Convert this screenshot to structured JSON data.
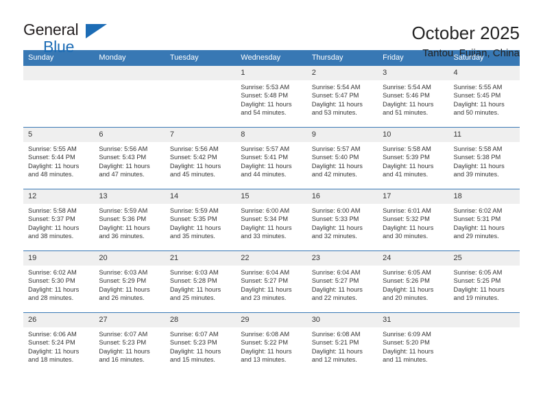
{
  "brand": {
    "name_part1": "General",
    "name_part2": "Blue"
  },
  "header": {
    "title": "October 2025",
    "subtitle": "Tantou, Fujian, China"
  },
  "colors": {
    "header_blue": "#3878b4",
    "brand_blue": "#1c6cb5",
    "daynum_bg": "#efefef",
    "text": "#333333"
  },
  "weekday_headers": [
    "Sunday",
    "Monday",
    "Tuesday",
    "Wednesday",
    "Thursday",
    "Friday",
    "Saturday"
  ],
  "weeks": [
    [
      {
        "day": "",
        "lines": []
      },
      {
        "day": "",
        "lines": []
      },
      {
        "day": "",
        "lines": []
      },
      {
        "day": "1",
        "lines": [
          "Sunrise: 5:53 AM",
          "Sunset: 5:48 PM",
          "Daylight: 11 hours",
          "and 54 minutes."
        ]
      },
      {
        "day": "2",
        "lines": [
          "Sunrise: 5:54 AM",
          "Sunset: 5:47 PM",
          "Daylight: 11 hours",
          "and 53 minutes."
        ]
      },
      {
        "day": "3",
        "lines": [
          "Sunrise: 5:54 AM",
          "Sunset: 5:46 PM",
          "Daylight: 11 hours",
          "and 51 minutes."
        ]
      },
      {
        "day": "4",
        "lines": [
          "Sunrise: 5:55 AM",
          "Sunset: 5:45 PM",
          "Daylight: 11 hours",
          "and 50 minutes."
        ]
      }
    ],
    [
      {
        "day": "5",
        "lines": [
          "Sunrise: 5:55 AM",
          "Sunset: 5:44 PM",
          "Daylight: 11 hours",
          "and 48 minutes."
        ]
      },
      {
        "day": "6",
        "lines": [
          "Sunrise: 5:56 AM",
          "Sunset: 5:43 PM",
          "Daylight: 11 hours",
          "and 47 minutes."
        ]
      },
      {
        "day": "7",
        "lines": [
          "Sunrise: 5:56 AM",
          "Sunset: 5:42 PM",
          "Daylight: 11 hours",
          "and 45 minutes."
        ]
      },
      {
        "day": "8",
        "lines": [
          "Sunrise: 5:57 AM",
          "Sunset: 5:41 PM",
          "Daylight: 11 hours",
          "and 44 minutes."
        ]
      },
      {
        "day": "9",
        "lines": [
          "Sunrise: 5:57 AM",
          "Sunset: 5:40 PM",
          "Daylight: 11 hours",
          "and 42 minutes."
        ]
      },
      {
        "day": "10",
        "lines": [
          "Sunrise: 5:58 AM",
          "Sunset: 5:39 PM",
          "Daylight: 11 hours",
          "and 41 minutes."
        ]
      },
      {
        "day": "11",
        "lines": [
          "Sunrise: 5:58 AM",
          "Sunset: 5:38 PM",
          "Daylight: 11 hours",
          "and 39 minutes."
        ]
      }
    ],
    [
      {
        "day": "12",
        "lines": [
          "Sunrise: 5:58 AM",
          "Sunset: 5:37 PM",
          "Daylight: 11 hours",
          "and 38 minutes."
        ]
      },
      {
        "day": "13",
        "lines": [
          "Sunrise: 5:59 AM",
          "Sunset: 5:36 PM",
          "Daylight: 11 hours",
          "and 36 minutes."
        ]
      },
      {
        "day": "14",
        "lines": [
          "Sunrise: 5:59 AM",
          "Sunset: 5:35 PM",
          "Daylight: 11 hours",
          "and 35 minutes."
        ]
      },
      {
        "day": "15",
        "lines": [
          "Sunrise: 6:00 AM",
          "Sunset: 5:34 PM",
          "Daylight: 11 hours",
          "and 33 minutes."
        ]
      },
      {
        "day": "16",
        "lines": [
          "Sunrise: 6:00 AM",
          "Sunset: 5:33 PM",
          "Daylight: 11 hours",
          "and 32 minutes."
        ]
      },
      {
        "day": "17",
        "lines": [
          "Sunrise: 6:01 AM",
          "Sunset: 5:32 PM",
          "Daylight: 11 hours",
          "and 30 minutes."
        ]
      },
      {
        "day": "18",
        "lines": [
          "Sunrise: 6:02 AM",
          "Sunset: 5:31 PM",
          "Daylight: 11 hours",
          "and 29 minutes."
        ]
      }
    ],
    [
      {
        "day": "19",
        "lines": [
          "Sunrise: 6:02 AM",
          "Sunset: 5:30 PM",
          "Daylight: 11 hours",
          "and 28 minutes."
        ]
      },
      {
        "day": "20",
        "lines": [
          "Sunrise: 6:03 AM",
          "Sunset: 5:29 PM",
          "Daylight: 11 hours",
          "and 26 minutes."
        ]
      },
      {
        "day": "21",
        "lines": [
          "Sunrise: 6:03 AM",
          "Sunset: 5:28 PM",
          "Daylight: 11 hours",
          "and 25 minutes."
        ]
      },
      {
        "day": "22",
        "lines": [
          "Sunrise: 6:04 AM",
          "Sunset: 5:27 PM",
          "Daylight: 11 hours",
          "and 23 minutes."
        ]
      },
      {
        "day": "23",
        "lines": [
          "Sunrise: 6:04 AM",
          "Sunset: 5:27 PM",
          "Daylight: 11 hours",
          "and 22 minutes."
        ]
      },
      {
        "day": "24",
        "lines": [
          "Sunrise: 6:05 AM",
          "Sunset: 5:26 PM",
          "Daylight: 11 hours",
          "and 20 minutes."
        ]
      },
      {
        "day": "25",
        "lines": [
          "Sunrise: 6:05 AM",
          "Sunset: 5:25 PM",
          "Daylight: 11 hours",
          "and 19 minutes."
        ]
      }
    ],
    [
      {
        "day": "26",
        "lines": [
          "Sunrise: 6:06 AM",
          "Sunset: 5:24 PM",
          "Daylight: 11 hours",
          "and 18 minutes."
        ]
      },
      {
        "day": "27",
        "lines": [
          "Sunrise: 6:07 AM",
          "Sunset: 5:23 PM",
          "Daylight: 11 hours",
          "and 16 minutes."
        ]
      },
      {
        "day": "28",
        "lines": [
          "Sunrise: 6:07 AM",
          "Sunset: 5:23 PM",
          "Daylight: 11 hours",
          "and 15 minutes."
        ]
      },
      {
        "day": "29",
        "lines": [
          "Sunrise: 6:08 AM",
          "Sunset: 5:22 PM",
          "Daylight: 11 hours",
          "and 13 minutes."
        ]
      },
      {
        "day": "30",
        "lines": [
          "Sunrise: 6:08 AM",
          "Sunset: 5:21 PM",
          "Daylight: 11 hours",
          "and 12 minutes."
        ]
      },
      {
        "day": "31",
        "lines": [
          "Sunrise: 6:09 AM",
          "Sunset: 5:20 PM",
          "Daylight: 11 hours",
          "and 11 minutes."
        ]
      },
      {
        "day": "",
        "lines": []
      }
    ]
  ]
}
